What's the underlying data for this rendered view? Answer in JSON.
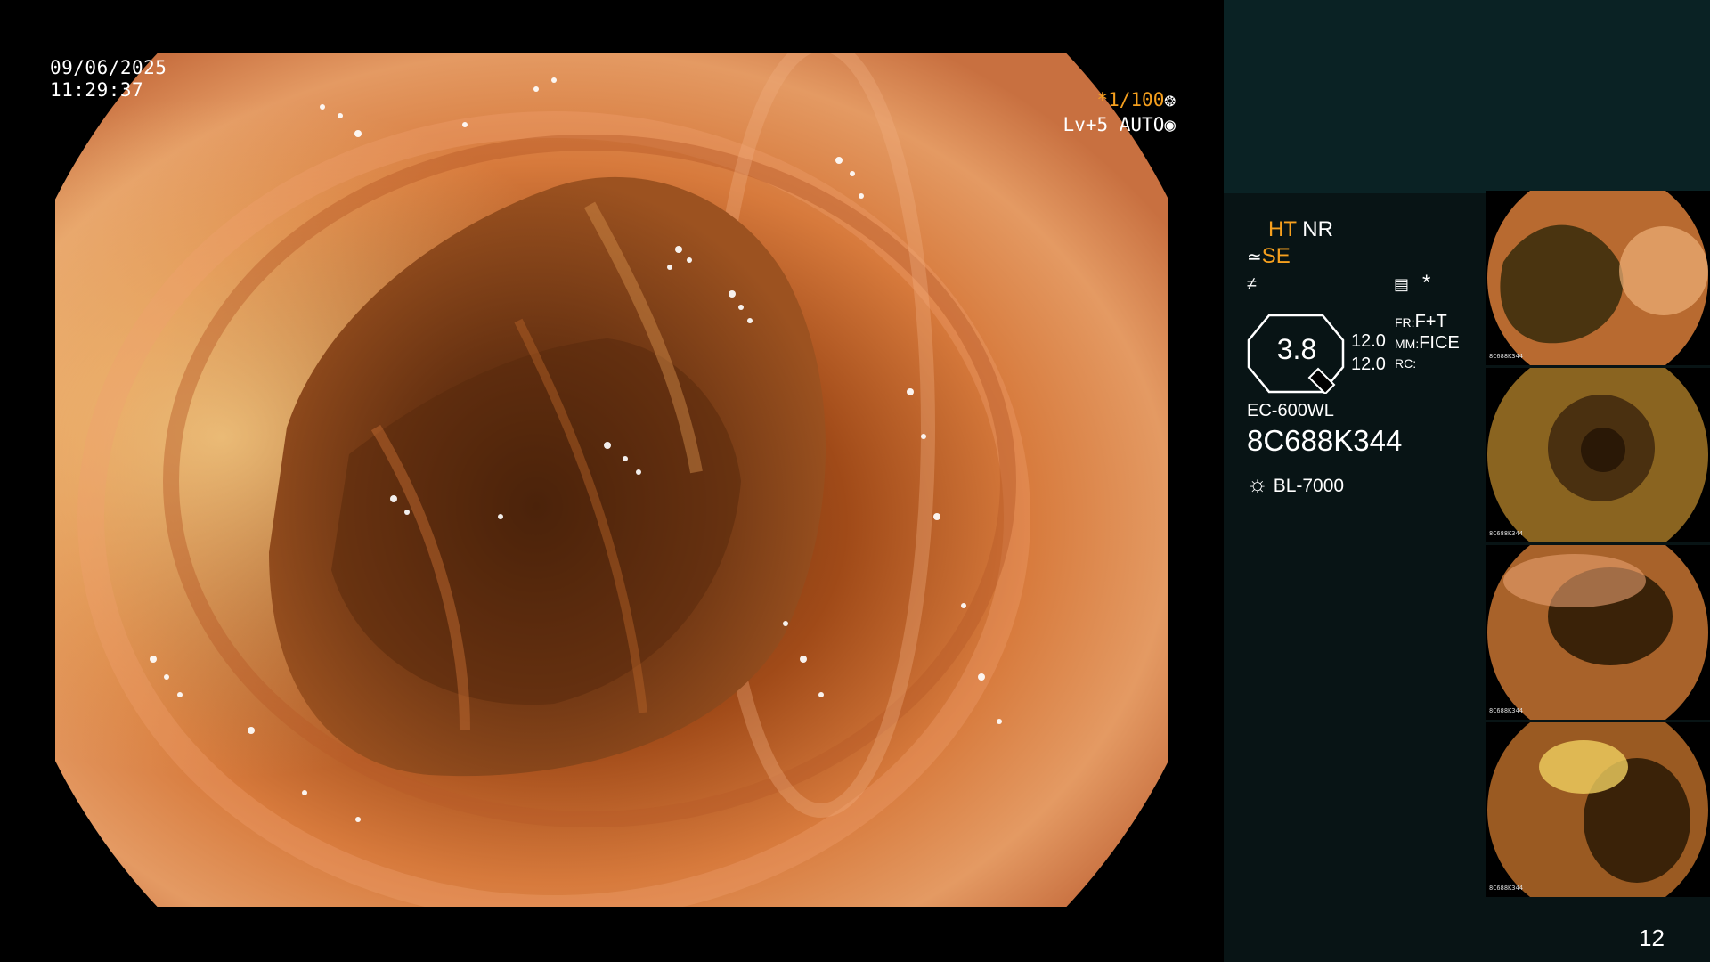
{
  "overlay": {
    "date": "09/06/2025",
    "time": "11:29:37",
    "shutter": "*1/100",
    "shutter_icon": "aperture-icon",
    "level": "Lv+5 AUTO",
    "level_icon": "iris-icon"
  },
  "info_panel": {
    "ht": "HT",
    "nr": "NR",
    "se": "SE",
    "zoom_value": "3.8",
    "value_top": "12.0",
    "value_bottom": "12.0",
    "fr_label": "FR:",
    "fr_value": "F+T",
    "mm_label": "MM:",
    "mm_value": "FICE",
    "rc_label": "RC:",
    "asterisk": "*",
    "scope_model": "EC-600WL",
    "serial": "8C688K344",
    "light_source": "BL-7000"
  },
  "thumbnails": [
    {
      "serial": "8C688K344"
    },
    {
      "serial": "8C688K344"
    },
    {
      "serial": "8C688K344"
    },
    {
      "serial": "8C688K344"
    }
  ],
  "page_count": "12",
  "colors": {
    "accent_orange": "#f6a01e",
    "panel_top": "#0a2224",
    "panel_bottom": "#081415"
  }
}
